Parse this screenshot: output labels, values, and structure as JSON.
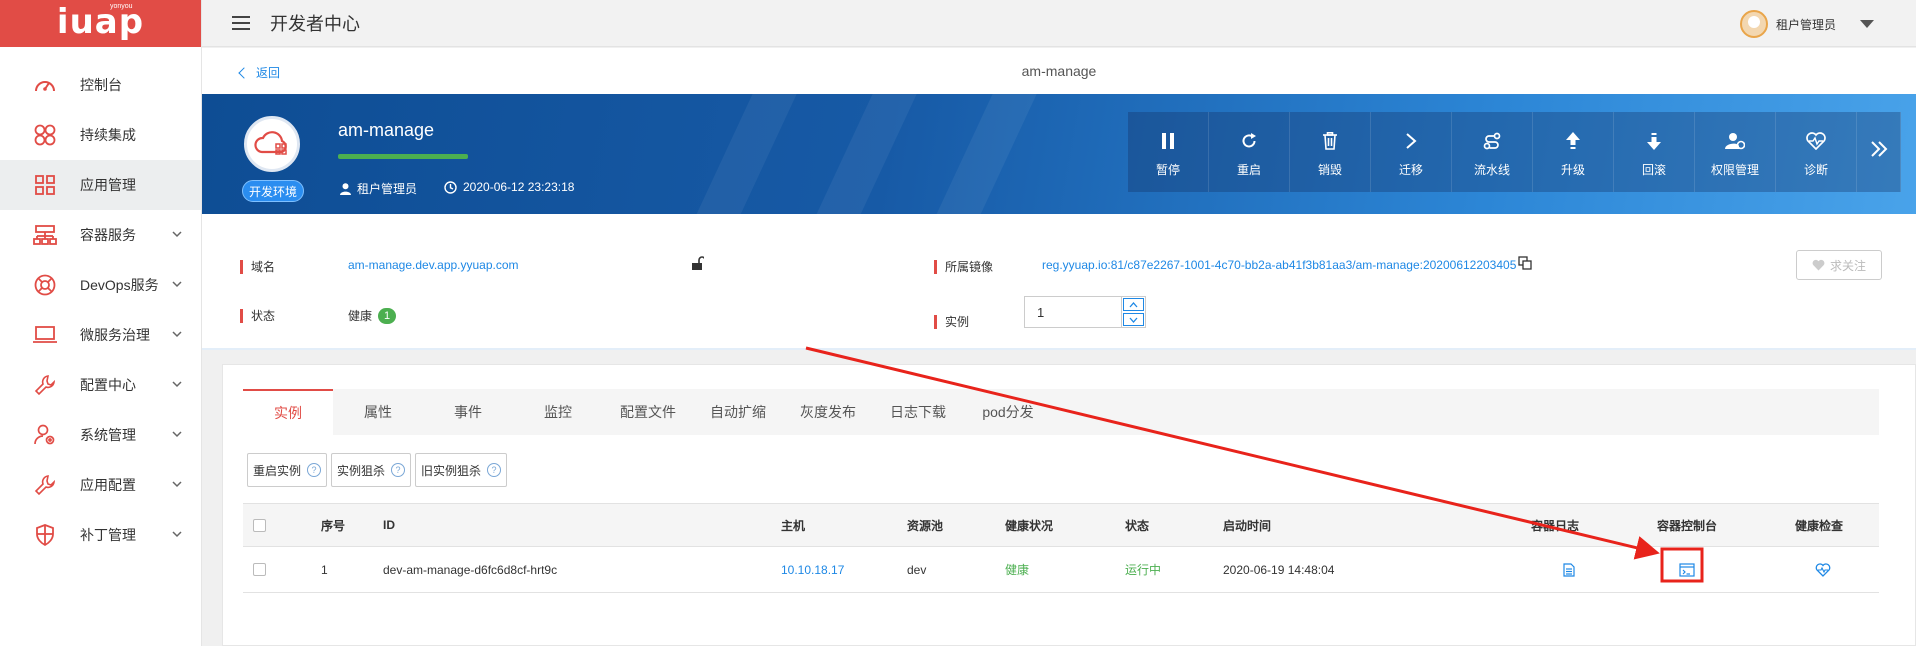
{
  "brand": {
    "logo_text": "iuap",
    "logo_sub": "yonyou"
  },
  "topbar": {
    "title": "开发者中心",
    "user_name": "租户管理员"
  },
  "sidebar": {
    "items": [
      {
        "label": "控制台",
        "icon": "dashboard-icon"
      },
      {
        "label": "持续集成",
        "icon": "flower-icon"
      },
      {
        "label": "应用管理",
        "icon": "grid-icon",
        "active": true
      },
      {
        "label": "容器服务",
        "icon": "hierarchy-icon"
      },
      {
        "label": "DevOps服务",
        "icon": "life-ring-icon"
      },
      {
        "label": "微服务治理",
        "icon": "laptop-icon"
      },
      {
        "label": "配置中心",
        "icon": "wrench-icon"
      },
      {
        "label": "系统管理",
        "icon": "user-gear-icon"
      },
      {
        "label": "应用配置",
        "icon": "wrench-icon"
      },
      {
        "label": "补丁管理",
        "icon": "shield-icon"
      }
    ]
  },
  "breadcrumb": {
    "back_label": "返回",
    "title": "am-manage"
  },
  "banner": {
    "app_name": "am-manage",
    "env_badge": "开发环境",
    "owner": "租户管理员",
    "created": "2020-06-12 23:23:18",
    "actions": [
      {
        "label": "暂停",
        "icon": "pause-icon"
      },
      {
        "label": "重启",
        "icon": "restart-icon"
      },
      {
        "label": "销毁",
        "icon": "trash-icon"
      },
      {
        "label": "迁移",
        "icon": "chevron-right-icon"
      },
      {
        "label": "流水线",
        "icon": "pipeline-icon"
      },
      {
        "label": "升级",
        "icon": "upgrade-icon"
      },
      {
        "label": "回滚",
        "icon": "rollback-icon"
      },
      {
        "label": "权限管理",
        "icon": "user-lock-icon"
      },
      {
        "label": "诊断",
        "icon": "heart-pulse-icon"
      }
    ]
  },
  "info": {
    "domain_label": "域名",
    "domain_value": "am-manage.dev.app.yyuap.com",
    "status_label": "状态",
    "status_value": "健康",
    "status_count": "1",
    "image_label": "所属镜像",
    "image_value": "reg.yyuap.io:81/c87e2267-1001-4c70-bb2a-ab41f3b81aa3/am-manage:20200612203405",
    "instances_label": "实例",
    "instances_value": "1",
    "follow_label": "求关注"
  },
  "tabs": [
    "实例",
    "属性",
    "事件",
    "监控",
    "配置文件",
    "自动扩缩",
    "灰度发布",
    "日志下载",
    "pod分发"
  ],
  "buttons": [
    "重启实例",
    "实例狙杀",
    "旧实例狙杀"
  ],
  "table": {
    "headers": {
      "index": "序号",
      "id": "ID",
      "host": "主机",
      "pool": "资源池",
      "health": "健康状况",
      "state": "状态",
      "start_time": "启动时间",
      "logs": "容器日志",
      "console": "容器控制台",
      "check": "健康检查"
    },
    "rows": [
      {
        "index": "1",
        "id": "dev-am-manage-d6fc6d8cf-hrt9c",
        "host": "10.10.18.17",
        "pool": "dev",
        "health": "健康",
        "state": "运行中",
        "start_time": "2020-06-19 14:48:04"
      }
    ]
  },
  "colors": {
    "brand_red": "#e14c46",
    "link_blue": "#1e88e5",
    "ok_green": "#4caf50",
    "annotation_red": "#e8231b"
  }
}
